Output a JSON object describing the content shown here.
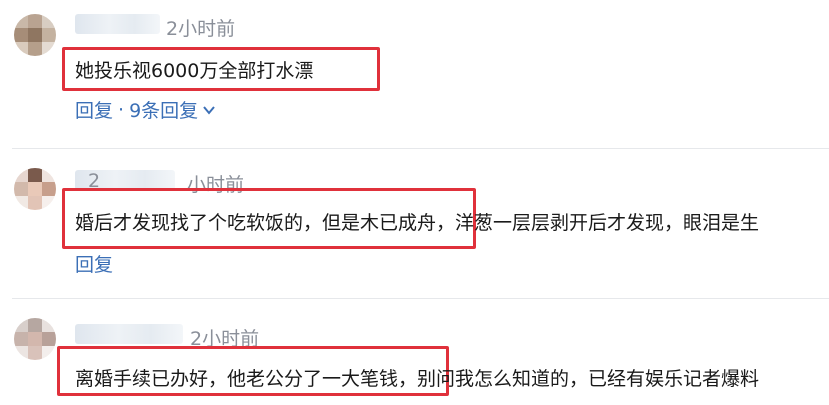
{
  "comments": [
    {
      "time": "2小时前",
      "content": "她投乐视6000万全部打水漂",
      "reply_label": "回复",
      "separator": "·",
      "replies_label": "9条回复"
    },
    {
      "time": "小时前",
      "username_fragment": "2",
      "content": "婚后才发现找了个吃软饭的，但是木已成舟，洋葱一层层剥开后才发现，眼泪是生",
      "reply_label": "回复"
    },
    {
      "time": "2小时前",
      "content": "离婚手续已办好，他老公分了一大笔钱，别问我怎么知道的，已经有娱乐记者爆料"
    }
  ],
  "colors": {
    "highlight_border": "#e0313b",
    "link": "#3b6fb6",
    "meta_text": "#8a8f99",
    "body_text": "#1a1a1a"
  }
}
